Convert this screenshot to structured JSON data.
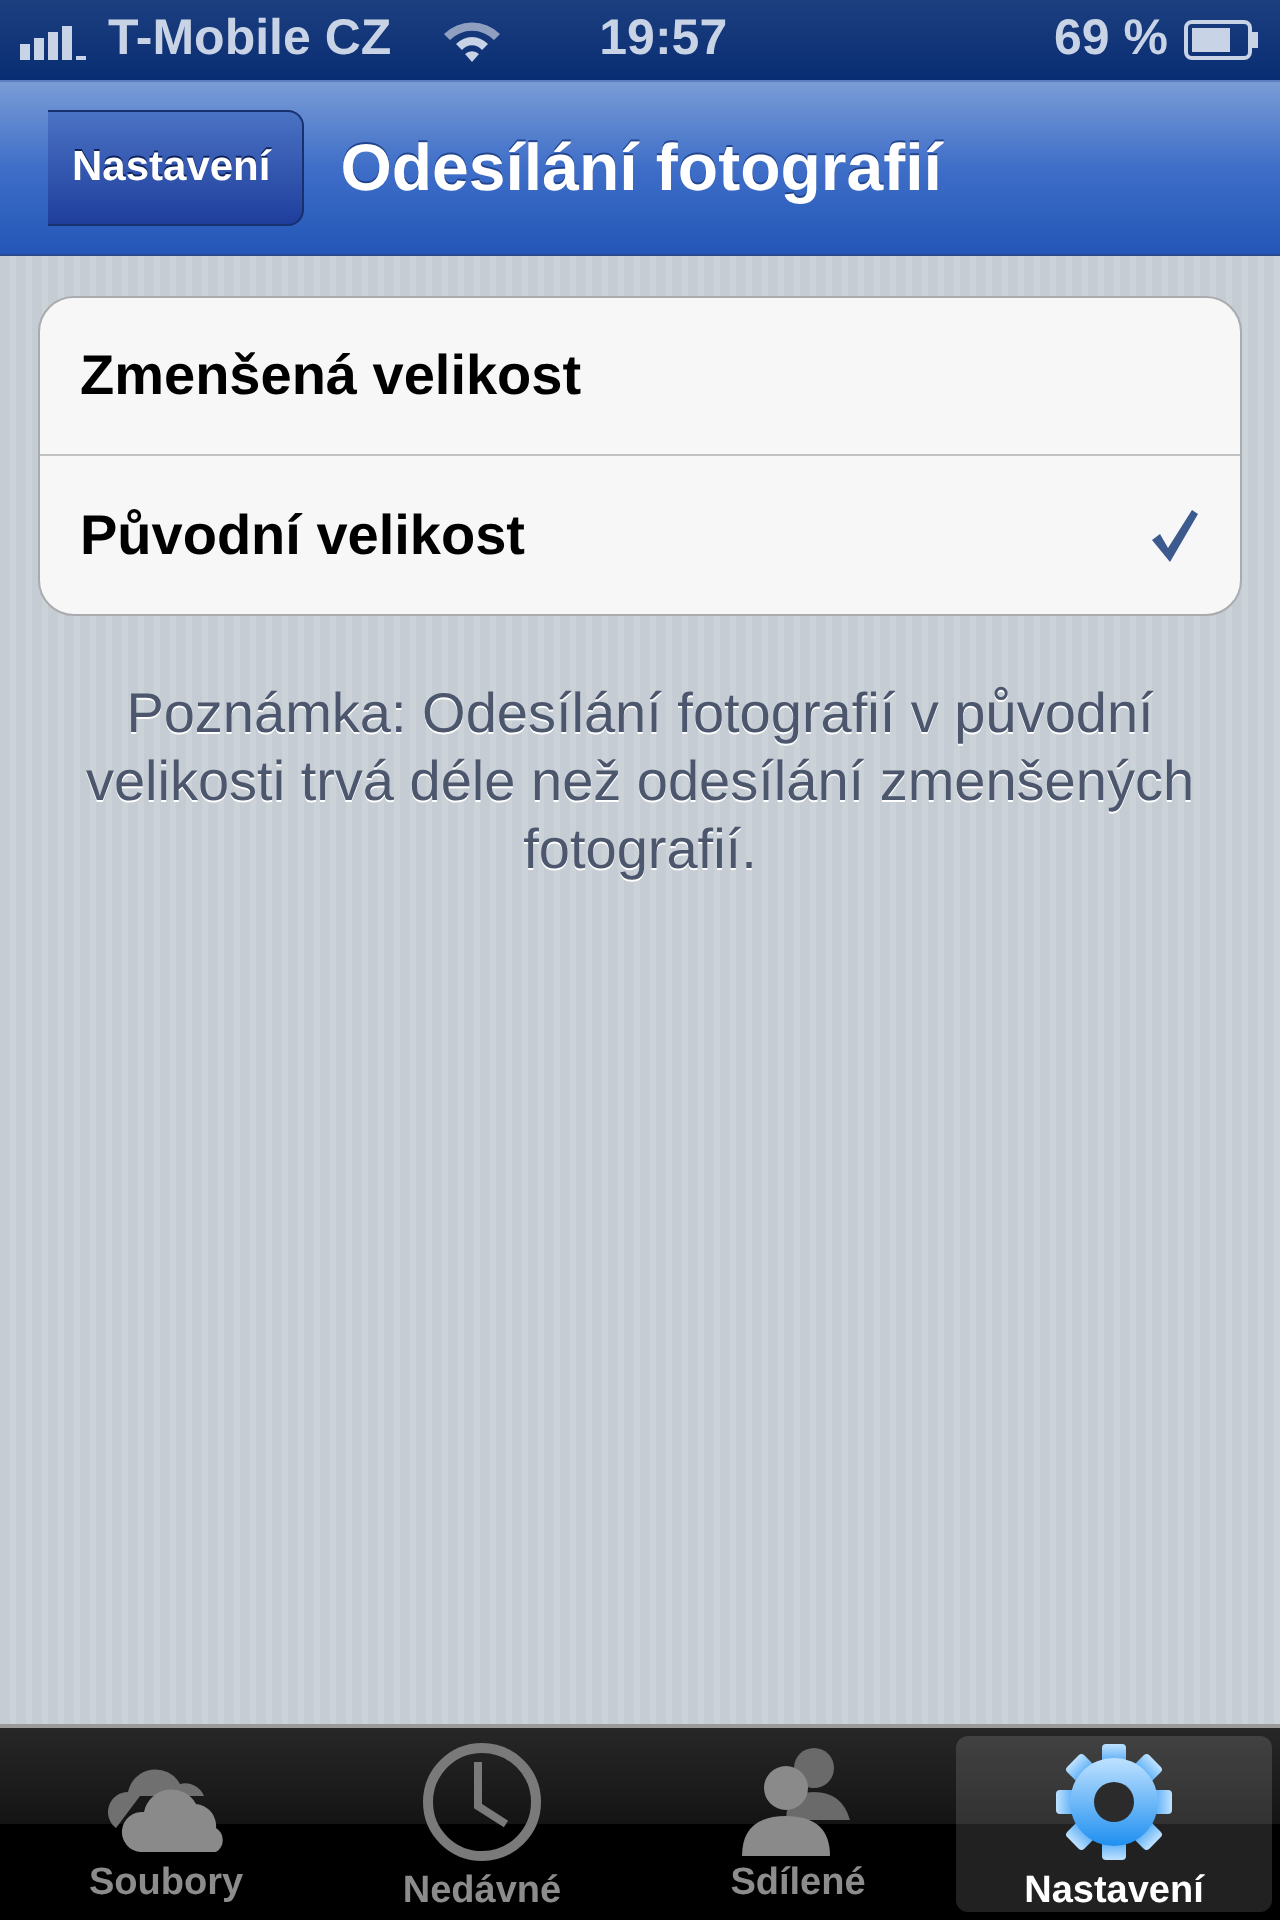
{
  "status_bar": {
    "carrier": "T-Mobile CZ",
    "time": "19:57",
    "battery": "69 %"
  },
  "nav_bar": {
    "back": "Nastavení",
    "title": "Odesílání fotografií"
  },
  "options": [
    {
      "label": "Zmenšená velikost",
      "selected": false
    },
    {
      "label": "Původní velikost",
      "selected": true
    }
  ],
  "note": "Poznámka: Odesílání fotografií v původní velikosti trvá déle než odesílání zmenšených fotografií.",
  "tab_bar": [
    {
      "label": "Soubory",
      "kind": "cloud",
      "selected": false
    },
    {
      "label": "Nedávné",
      "kind": "clock",
      "selected": false
    },
    {
      "label": "Sdílené",
      "kind": "people",
      "selected": false
    },
    {
      "label": "Nastavení",
      "kind": "gear",
      "selected": true
    }
  ]
}
